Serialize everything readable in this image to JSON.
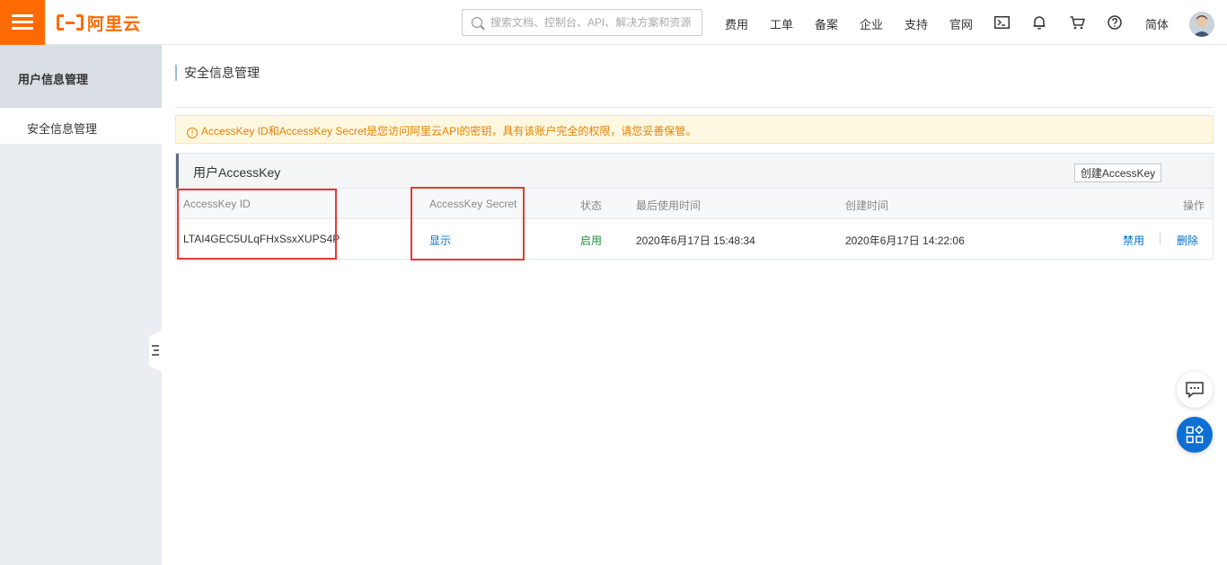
{
  "header": {
    "brand": "阿里云",
    "search_placeholder": "搜索文档、控制台、API、解决方案和资源",
    "nav": {
      "billing": "费用",
      "tickets": "工单",
      "icp": "备案",
      "enterprise": "企业",
      "support": "支持",
      "official_site": "官网",
      "language": "简体"
    },
    "icons": [
      "menu-icon",
      "search-icon",
      "terminal-icon",
      "bell-icon",
      "cart-icon",
      "help-icon",
      "avatar"
    ]
  },
  "sidebar": {
    "title": "用户信息管理",
    "items": [
      {
        "label": "安全信息管理"
      }
    ]
  },
  "main": {
    "title": "安全信息管理",
    "alert": "AccessKey ID和AccessKey Secret是您访问阿里云API的密钥，具有该账户完全的权限，请您妥善保管。",
    "panel": {
      "title": "用户AccessKey",
      "create_button": "创建AccessKey",
      "columns": {
        "id": "AccessKey ID",
        "secret": "AccessKey Secret",
        "status": "状态",
        "last_used": "最后使用时间",
        "created": "创建时间",
        "actions": "操作"
      },
      "rows": [
        {
          "id": "LTAI4GEC5ULqFHxSsxXUPS4P",
          "secret_action": "显示",
          "status": "启用",
          "last_used": "2020年6月17日 15:48:34",
          "created": "2020年6月17日 14:22:06",
          "disable_action": "禁用",
          "delete_action": "删除"
        }
      ]
    }
  },
  "colors": {
    "brand": "#ff6a00",
    "link": "#0070cc",
    "status_enabled": "#1e8e3e",
    "alert_text": "#e88100",
    "highlight_box": "#e53935"
  }
}
